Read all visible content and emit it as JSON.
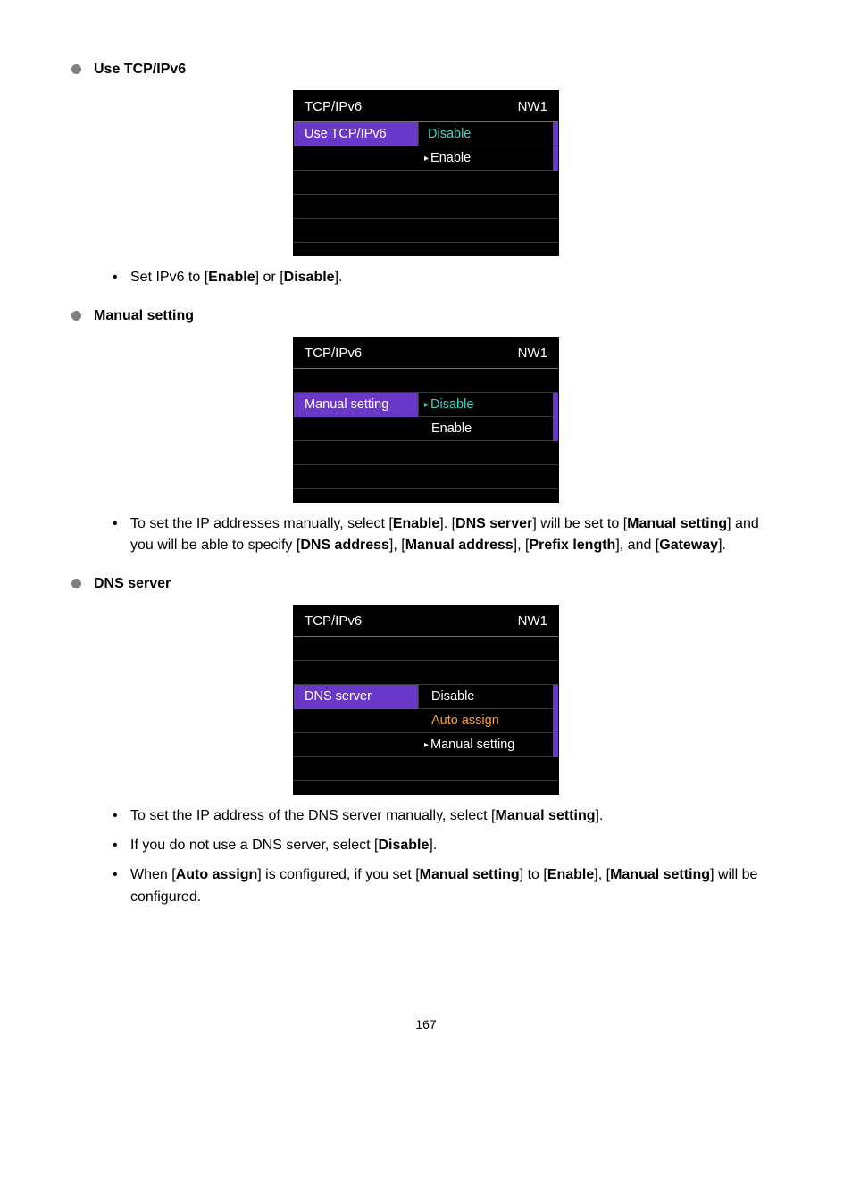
{
  "sections": {
    "use_tcp": {
      "title": "Use TCP/IPv6",
      "menu": {
        "menu_title": "TCP/IPv6",
        "menu_tag": "NW1",
        "row_label": "Use TCP/IPv6",
        "opt1": "Disable",
        "opt2": "Enable"
      },
      "notes": {
        "n1_a": "Set IPv6 to [",
        "n1_b": "Enable",
        "n1_c": "] or [",
        "n1_d": "Disable",
        "n1_e": "]."
      }
    },
    "manual": {
      "title": "Manual setting",
      "menu": {
        "menu_title": "TCP/IPv6",
        "menu_tag": "NW1",
        "row_label": "Manual setting",
        "opt1": "Disable",
        "opt2": "Enable"
      },
      "notes": {
        "n1_a": "To set the IP addresses manually, select [",
        "n1_b": "Enable",
        "n1_c": "]. [",
        "n1_d": "DNS server",
        "n1_e": "] will be set to [",
        "n1_f": "Manual setting",
        "n1_g": "] and you will be able to specify [",
        "n1_h": "DNS address",
        "n1_i": "], [",
        "n1_j": "Manual address",
        "n1_k": "], [",
        "n1_l": "Prefix length",
        "n1_m": "], and [",
        "n1_n": "Gateway",
        "n1_o": "]."
      }
    },
    "dns": {
      "title": "DNS server",
      "menu": {
        "menu_title": "TCP/IPv6",
        "menu_tag": "NW1",
        "row_label": "DNS server",
        "opt1": "Disable",
        "opt2": "Auto assign",
        "opt3": "Manual setting"
      },
      "notes": {
        "n1_a": "To set the IP address of the DNS server manually, select [",
        "n1_b": "Manual setting",
        "n1_c": "].",
        "n2_a": "If you do not use a DNS server, select [",
        "n2_b": "Disable",
        "n2_c": "].",
        "n3_a": "When [",
        "n3_b": "Auto assign",
        "n3_c": "] is configured, if you set [",
        "n3_d": "Manual setting",
        "n3_e": "] to [",
        "n3_f": "Enable",
        "n3_g": "], [",
        "n3_h": "Manual setting",
        "n3_i": "] will be configured."
      }
    }
  },
  "page_number": "167"
}
